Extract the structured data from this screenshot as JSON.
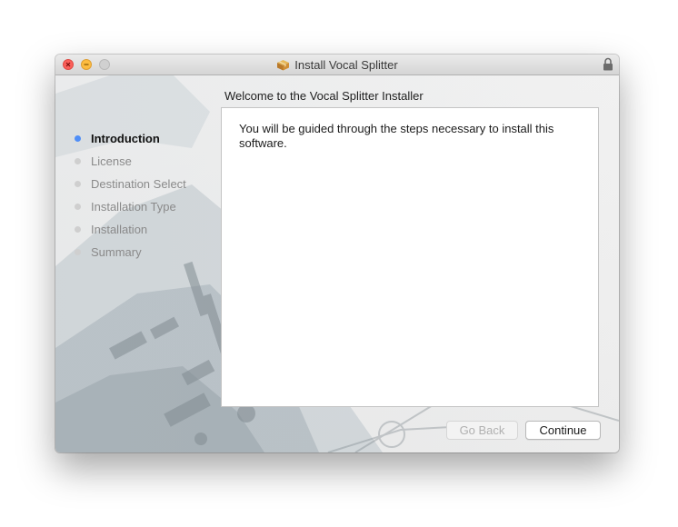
{
  "window": {
    "title": "Install Vocal Splitter",
    "title_icon": "package-icon",
    "lock_icon": "lock-icon"
  },
  "installer": {
    "heading": "Welcome to the Vocal Splitter Installer",
    "steps": [
      {
        "label": "Introduction",
        "active": true
      },
      {
        "label": "License",
        "active": false
      },
      {
        "label": "Destination Select",
        "active": false
      },
      {
        "label": "Installation Type",
        "active": false
      },
      {
        "label": "Installation",
        "active": false
      },
      {
        "label": "Summary",
        "active": false
      }
    ],
    "body_text": "You will be guided through the steps necessary to install this software.",
    "back_label": "Go Back",
    "continue_label": "Continue"
  },
  "colors": {
    "active_step": "#4f8ef7",
    "close": "#fc605b",
    "minimize": "#fdbc40"
  }
}
